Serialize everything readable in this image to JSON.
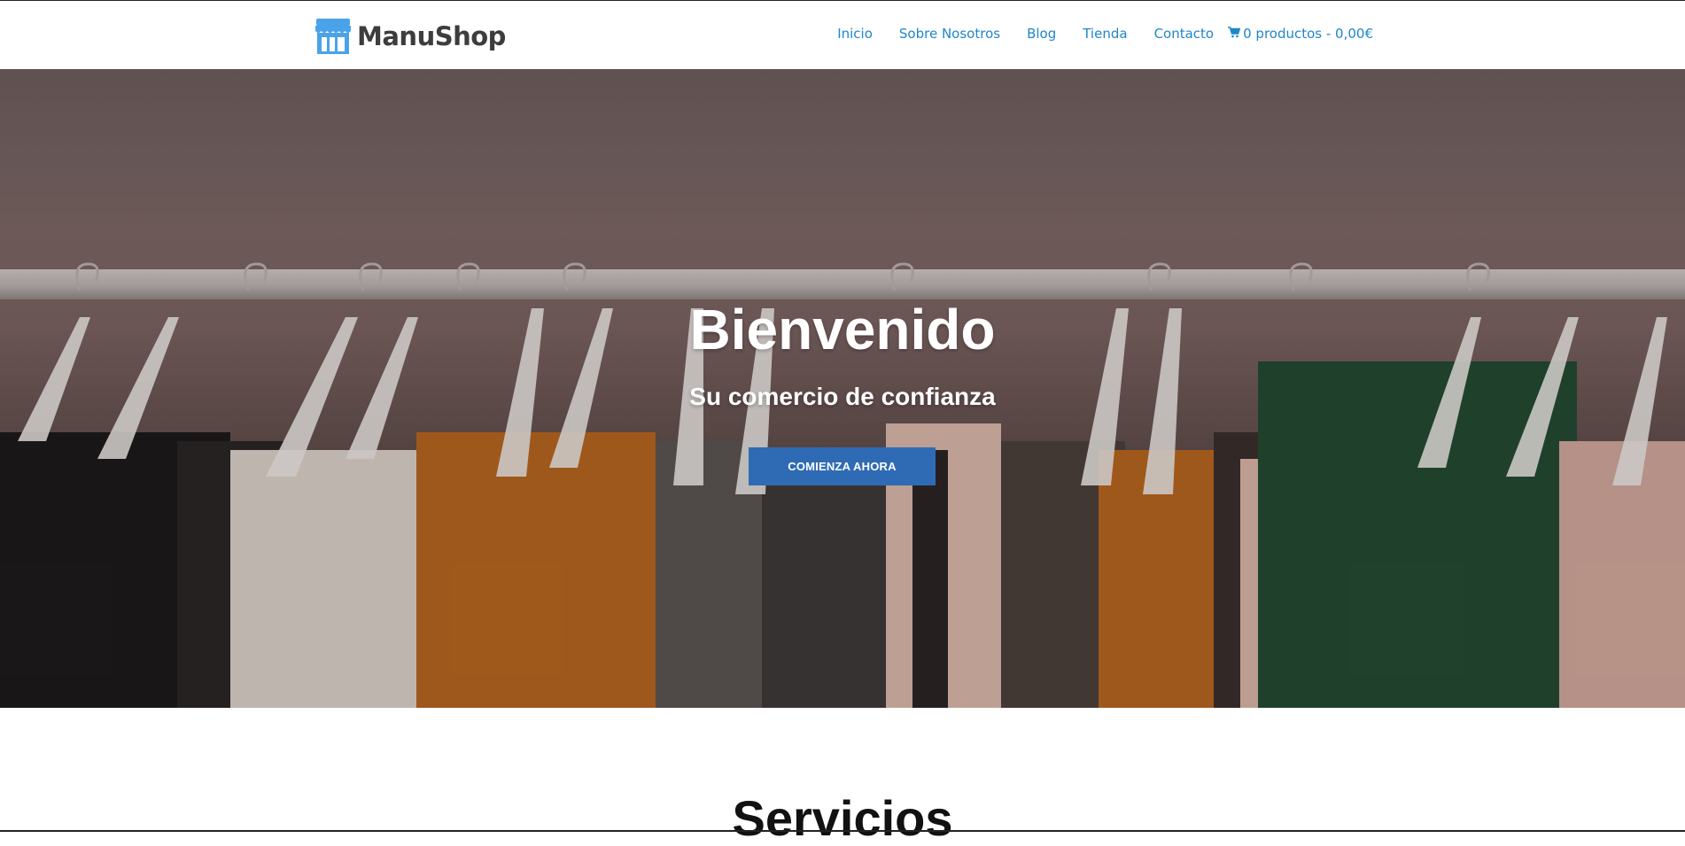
{
  "brand": {
    "name": "ManuShop",
    "color": "#4aa3e8"
  },
  "nav": {
    "items": [
      "Inicio",
      "Sobre Nosotros",
      "Blog",
      "Tienda",
      "Contacto"
    ],
    "cart_label": "0 productos - 0,00€",
    "link_color": "#1f86c8"
  },
  "hero": {
    "title": "Bienvenido",
    "subtitle": "Su comercio de confianza",
    "cta_label": "COMIENZA AHORA",
    "cta_color": "#2f6bb4"
  },
  "section": {
    "title": "Servicios"
  },
  "icons": {
    "logo": "store-icon",
    "cart": "cart-icon"
  }
}
